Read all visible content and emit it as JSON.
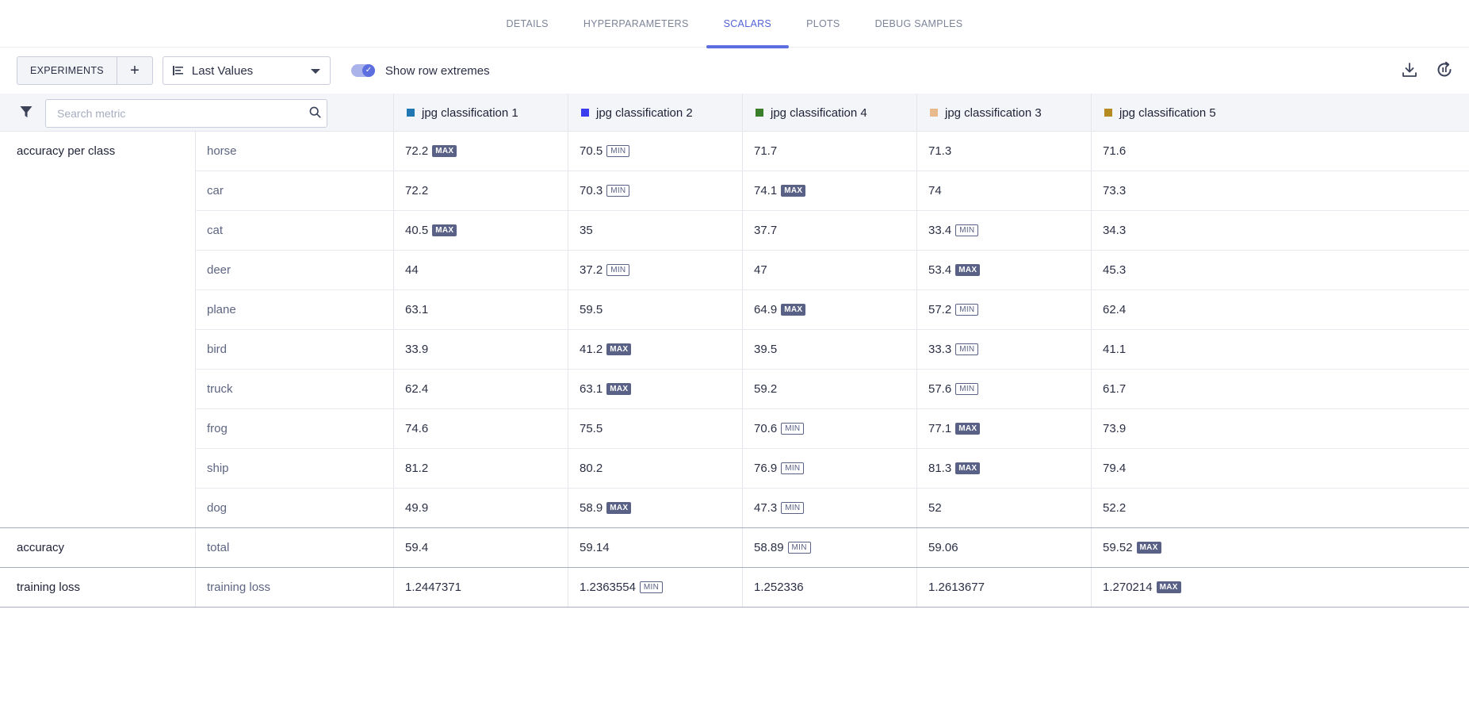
{
  "tabs": [
    {
      "label": "DETAILS",
      "active": false
    },
    {
      "label": "HYPERPARAMETERS",
      "active": false
    },
    {
      "label": "SCALARS",
      "active": true
    },
    {
      "label": "PLOTS",
      "active": false
    },
    {
      "label": "DEBUG SAMPLES",
      "active": false
    }
  ],
  "toolbar": {
    "experiments_label": "EXPERIMENTS",
    "add_label": "+",
    "value_mode": "Last Values",
    "toggle_label": "Show row extremes",
    "toggle_on": true
  },
  "search": {
    "placeholder": "Search metric"
  },
  "columns": [
    {
      "name": "jpg classification 1",
      "color": "#1f77b4"
    },
    {
      "name": "jpg classification 2",
      "color": "#3a3cf0"
    },
    {
      "name": "jpg classification 4",
      "color": "#3a7d2a"
    },
    {
      "name": "jpg classification 3",
      "color": "#e8b98c"
    },
    {
      "name": "jpg classification 5",
      "color": "#b58a1f"
    }
  ],
  "groups": [
    {
      "name": "accuracy per class",
      "rows": [
        {
          "metric": "horse",
          "values": [
            {
              "v": "72.2",
              "b": "MAX"
            },
            {
              "v": "70.5",
              "b": "MIN"
            },
            {
              "v": "71.7",
              "b": ""
            },
            {
              "v": "71.3",
              "b": ""
            },
            {
              "v": "71.6",
              "b": ""
            }
          ]
        },
        {
          "metric": "car",
          "values": [
            {
              "v": "72.2",
              "b": ""
            },
            {
              "v": "70.3",
              "b": "MIN"
            },
            {
              "v": "74.1",
              "b": "MAX"
            },
            {
              "v": "74",
              "b": ""
            },
            {
              "v": "73.3",
              "b": ""
            }
          ]
        },
        {
          "metric": "cat",
          "values": [
            {
              "v": "40.5",
              "b": "MAX"
            },
            {
              "v": "35",
              "b": ""
            },
            {
              "v": "37.7",
              "b": ""
            },
            {
              "v": "33.4",
              "b": "MIN"
            },
            {
              "v": "34.3",
              "b": ""
            }
          ]
        },
        {
          "metric": "deer",
          "values": [
            {
              "v": "44",
              "b": ""
            },
            {
              "v": "37.2",
              "b": "MIN"
            },
            {
              "v": "47",
              "b": ""
            },
            {
              "v": "53.4",
              "b": "MAX"
            },
            {
              "v": "45.3",
              "b": ""
            }
          ]
        },
        {
          "metric": "plane",
          "values": [
            {
              "v": "63.1",
              "b": ""
            },
            {
              "v": "59.5",
              "b": ""
            },
            {
              "v": "64.9",
              "b": "MAX"
            },
            {
              "v": "57.2",
              "b": "MIN"
            },
            {
              "v": "62.4",
              "b": ""
            }
          ]
        },
        {
          "metric": "bird",
          "values": [
            {
              "v": "33.9",
              "b": ""
            },
            {
              "v": "41.2",
              "b": "MAX"
            },
            {
              "v": "39.5",
              "b": ""
            },
            {
              "v": "33.3",
              "b": "MIN"
            },
            {
              "v": "41.1",
              "b": ""
            }
          ]
        },
        {
          "metric": "truck",
          "values": [
            {
              "v": "62.4",
              "b": ""
            },
            {
              "v": "63.1",
              "b": "MAX"
            },
            {
              "v": "59.2",
              "b": ""
            },
            {
              "v": "57.6",
              "b": "MIN"
            },
            {
              "v": "61.7",
              "b": ""
            }
          ]
        },
        {
          "metric": "frog",
          "values": [
            {
              "v": "74.6",
              "b": ""
            },
            {
              "v": "75.5",
              "b": ""
            },
            {
              "v": "70.6",
              "b": "MIN"
            },
            {
              "v": "77.1",
              "b": "MAX"
            },
            {
              "v": "73.9",
              "b": ""
            }
          ]
        },
        {
          "metric": "ship",
          "values": [
            {
              "v": "81.2",
              "b": ""
            },
            {
              "v": "80.2",
              "b": ""
            },
            {
              "v": "76.9",
              "b": "MIN"
            },
            {
              "v": "81.3",
              "b": "MAX"
            },
            {
              "v": "79.4",
              "b": ""
            }
          ]
        },
        {
          "metric": "dog",
          "values": [
            {
              "v": "49.9",
              "b": ""
            },
            {
              "v": "58.9",
              "b": "MAX"
            },
            {
              "v": "47.3",
              "b": "MIN"
            },
            {
              "v": "52",
              "b": ""
            },
            {
              "v": "52.2",
              "b": ""
            }
          ]
        }
      ]
    },
    {
      "name": "accuracy",
      "rows": [
        {
          "metric": "total",
          "values": [
            {
              "v": "59.4",
              "b": ""
            },
            {
              "v": "59.14",
              "b": ""
            },
            {
              "v": "58.89",
              "b": "MIN"
            },
            {
              "v": "59.06",
              "b": ""
            },
            {
              "v": "59.52",
              "b": "MAX"
            }
          ]
        }
      ]
    },
    {
      "name": "training loss",
      "rows": [
        {
          "metric": "training loss",
          "values": [
            {
              "v": "1.2447371",
              "b": ""
            },
            {
              "v": "1.2363554",
              "b": "MIN"
            },
            {
              "v": "1.252336",
              "b": ""
            },
            {
              "v": "1.2613677",
              "b": ""
            },
            {
              "v": "1.270214",
              "b": "MAX"
            }
          ]
        }
      ]
    }
  ]
}
